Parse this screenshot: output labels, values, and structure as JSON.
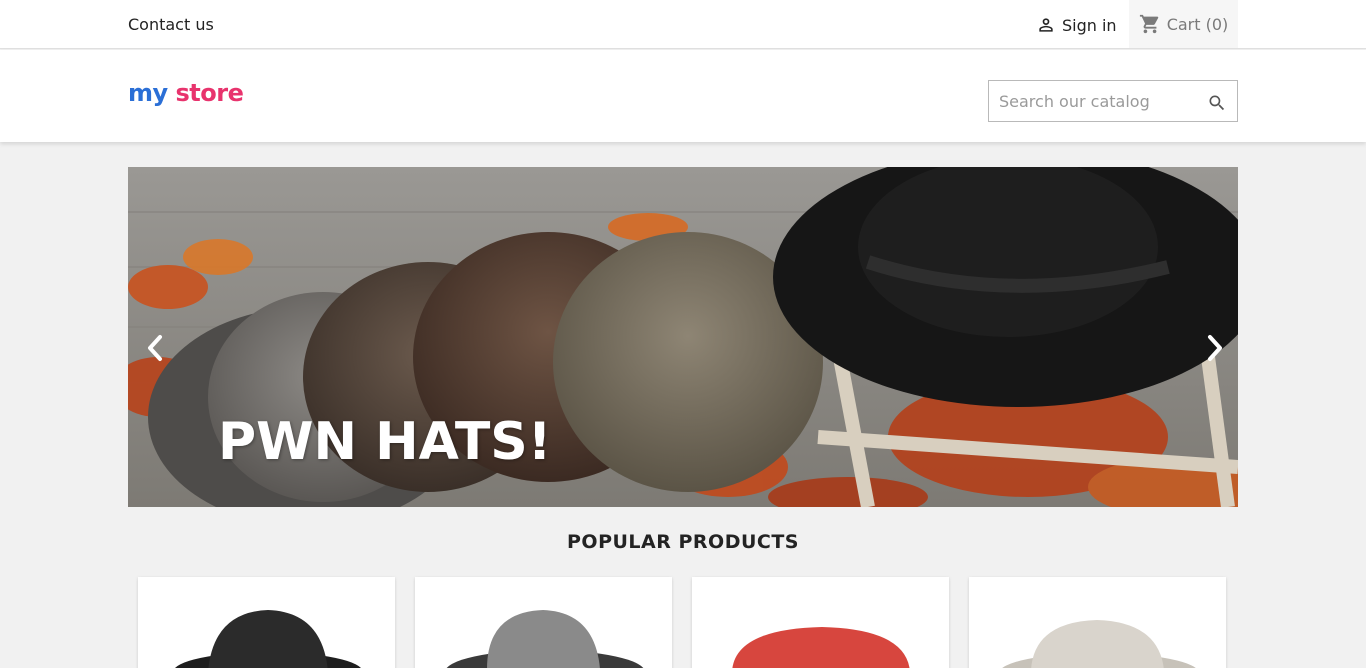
{
  "topbar": {
    "contact_label": "Contact us",
    "signin_label": "Sign in",
    "cart_label": "Cart",
    "cart_count": "(0)"
  },
  "header": {
    "logo_part1": "my",
    "logo_part2": "store",
    "search_placeholder": "Search our catalog"
  },
  "banner": {
    "caption": "PWN HATS!"
  },
  "popular": {
    "title": "POPULAR PRODUCTS",
    "products": [
      {
        "color": "#2b2b2b"
      },
      {
        "color": "#8a8a8a"
      },
      {
        "color": "#d7463e"
      },
      {
        "color": "#d9d4cc"
      }
    ]
  },
  "colors": {
    "cart_bg": "#f6f6f6",
    "page_bg": "#f1f1f1",
    "logo_blue": "#2b6fd6",
    "logo_pink": "#e8336d",
    "logo_orange": "#f5a623",
    "logo_teal": "#1fb8c9"
  }
}
